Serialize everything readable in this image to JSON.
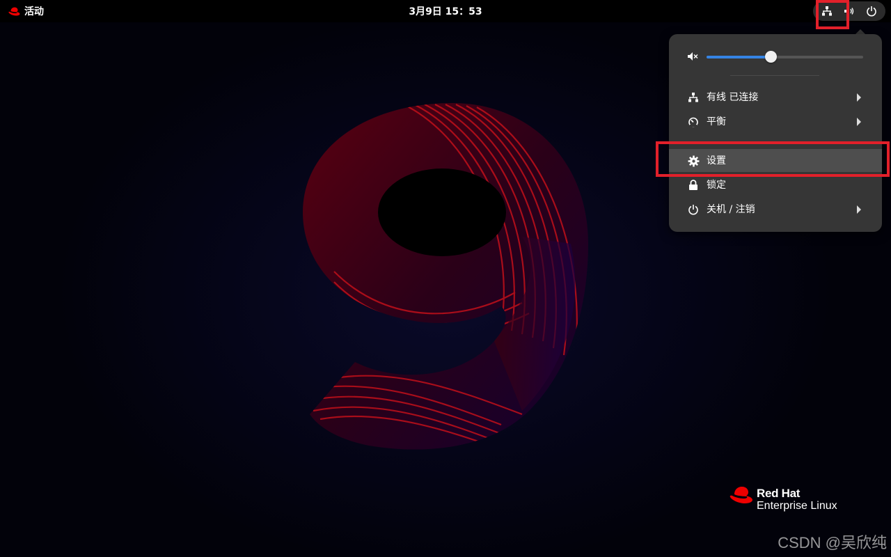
{
  "topbar": {
    "activities_label": "活动",
    "clock": "3月9日  15：53"
  },
  "icons": {
    "activities": "redhat-logo-icon",
    "network": "network-wired-icon",
    "volume": "volume-icon",
    "power": "power-icon"
  },
  "menu": {
    "volume": {
      "icon": "volume-muted-icon",
      "level": 0.41
    },
    "items": [
      {
        "label": "有线 已连接",
        "icon": "network-wired-icon",
        "has_submenu": true
      },
      {
        "label": "平衡",
        "icon": "power-profile-icon",
        "has_submenu": true
      },
      {
        "label": "设置",
        "icon": "gear-icon",
        "has_submenu": false,
        "highlighted": true
      },
      {
        "label": "锁定",
        "icon": "lock-icon",
        "has_submenu": false
      },
      {
        "label": "关机 / 注销",
        "icon": "power-icon",
        "has_submenu": true
      }
    ]
  },
  "branding": {
    "line1": "Red Hat",
    "line2": "Enterprise Linux"
  },
  "watermark": "CSDN @吴欣纯",
  "colors": {
    "accent": "#3584e4",
    "annotation": "#e2202a",
    "brand_red": "#ee0000"
  }
}
